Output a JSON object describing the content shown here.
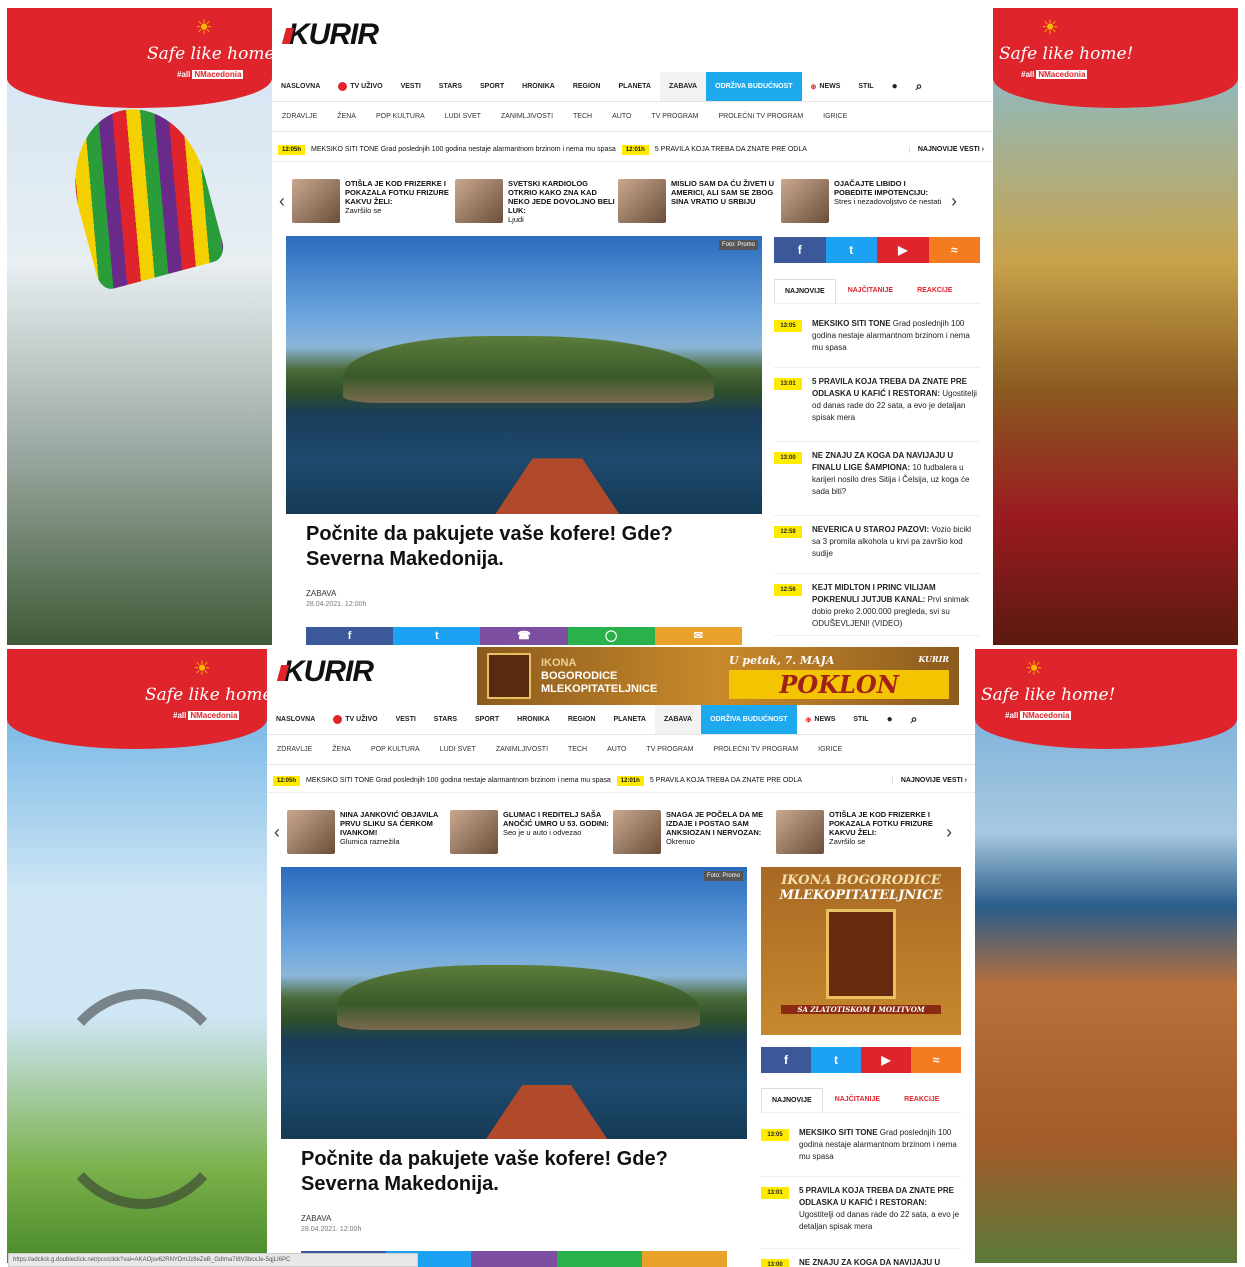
{
  "ads": {
    "slogan": "Safe like home!",
    "tag_prefix": "#all",
    "tag_brand": "NMacedonia"
  },
  "site": {
    "logo": "KURIR",
    "nav": [
      "NASLOVNA",
      "TV UŽIVO",
      "VESTI",
      "STARS",
      "SPORT",
      "HRONIKA",
      "REGION",
      "PLANETA",
      "ZABAVA",
      "ODRŽIVA BUDUĆNOST",
      "NEWS",
      "STIL"
    ],
    "subnav": [
      "ZDRAVLJE",
      "ŽENA",
      "POP KULTURA",
      "LUDI SVET",
      "ZANIMLJIVOSTI",
      "TECH",
      "AUTO",
      "TV PROGRAM",
      "PROLEĆNI TV PROGRAM",
      "IGRICE"
    ],
    "ticker": [
      {
        "time": "12:05h",
        "text": "MEKSIKO SITI TONE Grad poslednjih 100 godina nestaje alarmantnom brzinom i nema mu spasa"
      },
      {
        "time": "12:01h",
        "text": "5 PRAVILA KOJA TREBA DA ZNATE PRE ODLA"
      }
    ],
    "ticker_more": "NAJNOVIJE VESTI ›",
    "foto": "Foto: Promo",
    "headline": "Počnite da pakujete vaše kofere! Gde? Severna Makedonija.",
    "category": "ZABAVA",
    "datetime": "28.04.2021. 12:00h",
    "tabs": [
      "NAJNOVIJE",
      "NAJČITANIJE",
      "REAKCIJE"
    ],
    "feed": [
      {
        "time": "13:05",
        "title": "MEKSIKO SITI TONE",
        "text": "Grad poslednjih 100 godina nestaje alarmantnom brzinom i nema mu spasa"
      },
      {
        "time": "13:01",
        "title": "5 PRAVILA KOJA TREBA DA ZNATE PRE ODLASKA U KAFIĆ I RESTORAN:",
        "text": "Ugostitelji od danas rade do 22 sata, a evo je detaljan spisak mera"
      },
      {
        "time": "13:00",
        "title": "NE ZNAJU ZA KOGA DA NAVIJAJU U FINALU LIGE ŠAMPIONA:",
        "text": "10 fudbalera u karijeri nosilo dres Sitija i Čelsija, uz koga će sada biti?"
      },
      {
        "time": "12:58",
        "title": "NEVERICA U STAROJ PAZOVI:",
        "text": "Vozio bicikl sa 3 promila alkohola u krvi pa završio kod sudije"
      },
      {
        "time": "12:56",
        "title": "KEJT MIDLTON I PRINC VILIJAM POKRENULI JUTJUB KANAL:",
        "text": "Prvi snimak dobio preko 2.000.000 pregleda, svi su ODUŠEVLJENI! (VIDEO)"
      }
    ]
  },
  "top": {
    "reco": [
      {
        "title": "OTIŠLA JE KOD FRIZERKE I POKAZALA FOTKU FRIZURE KAKVU ŽELI:",
        "sub": "Završilo se"
      },
      {
        "title": "SVETSKI KARDIOLOG OTKRIO KAKO ZNA KAD NEKO JEDE DOVOLJNO BELI LUK:",
        "sub": "Ljudi"
      },
      {
        "title": "MISLIO SAM DA ĆU ŽIVETI U AMERICI, ALI SAM SE ZBOG SINA VRATIO U SRBIJU",
        "sub": ""
      },
      {
        "title": "OJAČAJTE LIBIDO I POBEDITE IMPOTENCIJU:",
        "sub": "Stres i nezadovoljstvo će nestati"
      }
    ]
  },
  "bottom": {
    "banner": {
      "line1": "IKONA",
      "line2": "BOGORODICE",
      "line3": "MLEKOPITATELJNICE",
      "date": "U petak, 7. MAJA",
      "brand": "KURIR",
      "gift": "POKLON"
    },
    "sidead": {
      "line1": "IKONA BOGORODICE",
      "line2": "MLEKOPITATELJNICE",
      "foot": "SA ZLATOTISKOM I MOLITVOM"
    },
    "reco": [
      {
        "title": "NINA JANKOVIĆ OBJAVILA PRVU SLIKU SA ĆERKOM IVANKOM!",
        "sub": "Glumica raznežila"
      },
      {
        "title": "GLUMAC I REDITELJ SAŠA ANOČIĆ UMRO U 53. GODINI:",
        "sub": "Seo je u auto i odvezao"
      },
      {
        "title": "SNAGA JE POČELA DA ME IZDAJE I POSTAO SAM ANKSIOZAN I NERVOZAN:",
        "sub": "Okrenuo"
      },
      {
        "title": "OTIŠLA JE KOD FRIZERKE I POKAZALA FOTKU FRIZURE KAKVU ŽELI:",
        "sub": "Završilo se"
      }
    ],
    "status_url": "https://adclick.g.doubleclick.net/pcs/click?xai=AKAOjsv62RNYDmJz8eZeB_GdIma7I8V3bcxJe-5qjLI6PC"
  }
}
